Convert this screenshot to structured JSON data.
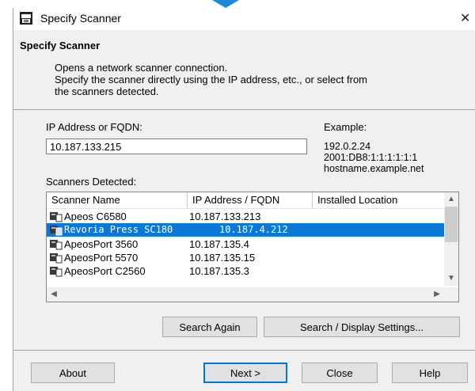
{
  "window": {
    "title": "Specify Scanner",
    "close_glyph": "✕"
  },
  "header": {
    "title": "Specify Scanner",
    "desc_line1": "Opens a network scanner connection.",
    "desc_line2": "Specify the scanner directly using the IP address, etc., or select from",
    "desc_line3": "the scanners detected."
  },
  "ip": {
    "label": "IP Address or FQDN:",
    "value": "10.187.133.215"
  },
  "example": {
    "label": "Example:",
    "line1": "192.0.2.24",
    "line2": "2001:DB8:1:1:1:1:1:1",
    "line3": "hostname.example.net"
  },
  "scanners": {
    "label": "Scanners Detected:",
    "columns": [
      "Scanner Name",
      "IP Address / FQDN",
      "Installed Location"
    ],
    "rows": [
      {
        "name": "Apeos C6580",
        "address": "10.187.133.213"
      },
      {
        "name": "Revoria Press SC180",
        "address": "10.187.4.212",
        "selected": true
      },
      {
        "name": "ApeosPort 3560",
        "address": "10.187.135.4"
      },
      {
        "name": "ApeosPort 5570",
        "address": "10.187.135.15"
      },
      {
        "name": "ApeosPort C2560",
        "address": "10.187.135.3"
      }
    ]
  },
  "buttons": {
    "search_again": "Search Again",
    "search_display": "Search / Display Settings...",
    "about": "About",
    "next": "Next >",
    "close": "Close",
    "help": "Help"
  },
  "colors": {
    "selection": "#0a78d7",
    "accent_arrow": "#1e88d4"
  }
}
